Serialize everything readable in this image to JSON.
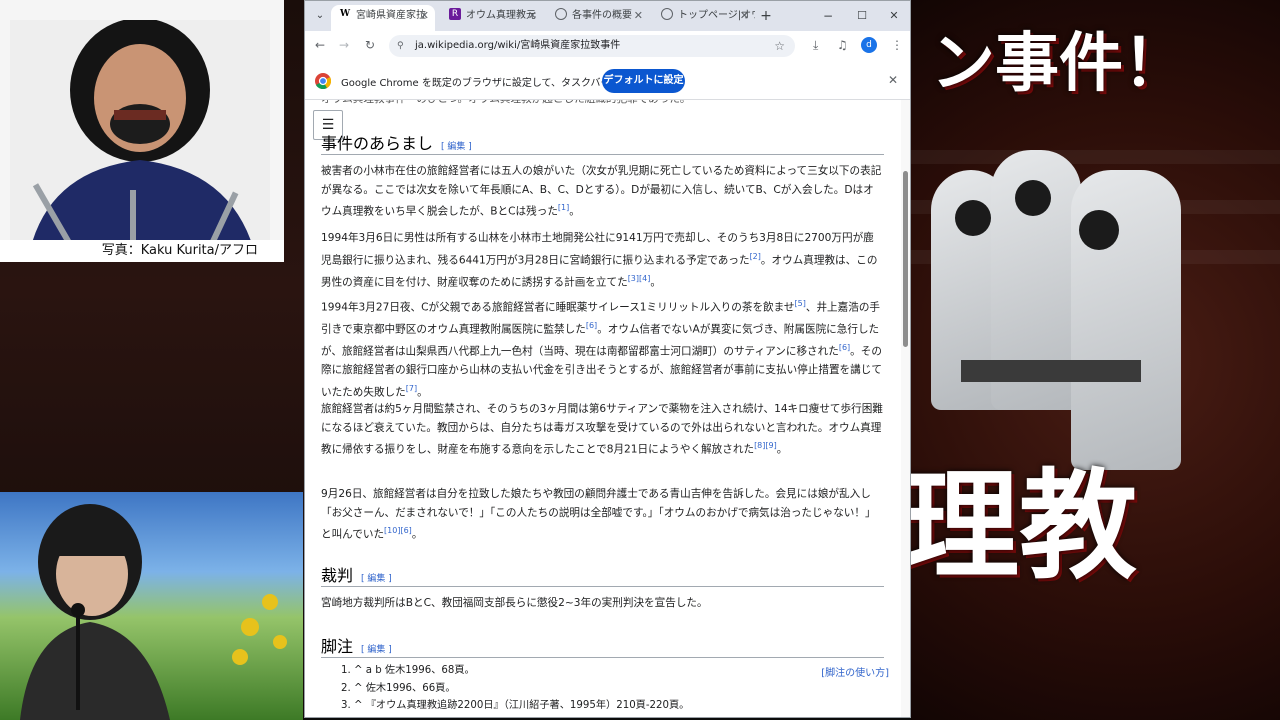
{
  "thumbnail": {
    "headline_top": "ン事件！",
    "headline_bottom": "理教",
    "photo_credit": "写真：Kaku Kurita/アフロ"
  },
  "browser": {
    "tabs": [
      {
        "title": "宮崎県資産家拉",
        "favicon": "W",
        "active": true
      },
      {
        "title": "オウム真理教元",
        "favicon": "R",
        "active": false
      },
      {
        "title": "各事件の概要",
        "favicon": "globe",
        "active": false
      },
      {
        "title": "トップページ|オウ",
        "favicon": "globe",
        "active": false
      }
    ],
    "window_controls": {
      "minimize": "−",
      "maximize": "☐",
      "close": "✕"
    },
    "url": "ja.wikipedia.org/wiki/宮崎県資産家拉致事件",
    "infobar": {
      "message": "Google Chrome を既定のブラウザに設定して、タスクバーに固定する",
      "button": "デフォルトに設定",
      "close": "✕"
    },
    "profile_initial": "d"
  },
  "article": {
    "partial_top": "オウム真理教事件　のひとつ。オウム真理教が起こした組織的犯罪であった。",
    "section1": {
      "title": "事件のあらまし",
      "edit": "編集"
    },
    "p1": "被害者の小林市在住の旅館経営者には五人の娘がいた（次女が乳児期に死亡しているため資料によって三女以下の表記が異なる。ここでは次女を除いて年長順にA、B、C、Dとする）。Dが最初に入信し、続いてB、Cが入会した。Dはオウム真理教をいち早く脱会したが、BとCは残った",
    "p1_ref": "[1]",
    "p2": "1994年3月6日に男性は所有する山林を小林市土地開発公社に9141万円で売却し、そのうち3月8日に2700万円が鹿児島銀行に振り込まれ、残る6441万円が3月28日に宮崎銀行に振り込まれる予定であった",
    "p2_ref": "[2]",
    "p2b": "。オウム真理教は、この男性の資産に目を付け、財産収奪のために誘拐する計画を立てた",
    "p2b_ref": "[3][4]",
    "p3": "1994年3月27日夜、Cが父親である旅館経営者に睡眠薬サイレース1ミリリットル入りの茶を飲ませ",
    "p3_ref1": "[5]",
    "p3b": "、井上嘉浩の手引きで東京都中野区のオウム真理教附属医院に監禁した",
    "p3_ref2": "[6]",
    "p3c": "。オウム信者でないAが異変に気づき、附属医院に急行したが、旅館経営者は山梨県西八代郡上九一色村（当時、現在は南都留郡富士河口湖町）のサティアンに移された",
    "p3_ref3": "[6]",
    "p3d": "。その際に旅館経営者の銀行口座から山林の支払い代金を引き出そうとするが、旅館経営者が事前に支払い停止措置を講じていたため失敗した",
    "p3_ref4": "[7]",
    "p4": "旅館経営者は約5ヶ月間監禁され、そのうちの3ヶ月間は第6サティアンで薬物を注入され続け、14キロ痩せて歩行困難になるほど衰えていた。教団からは、自分たちは毒ガス攻撃を受けているので外は出られないと言われた。オウム真理教に帰依する振りをし、財産を布施する意向を示したことで8月21日にようやく解放された",
    "p4_ref": "[8][9]",
    "p5": "9月26日、旅館経営者は自分を拉致した娘たちや教団の顧問弁護士である青山吉伸を告訴した。会見には娘が乱入し「お父さーん、だまされないで！」「この人たちの説明は全部嘘です。」「オウムのおかげで病気は治ったじゃない！」と叫んでいた",
    "p5_ref": "[10][6]",
    "section2": {
      "title": "裁判",
      "edit": "編集"
    },
    "p6": "宮崎地方裁判所はBとC、教団福岡支部長らに懲役2~3年の実刑判決を宣告した。",
    "section3": {
      "title": "脚注",
      "edit": "編集"
    },
    "footnote_help": "[脚注の使い方]",
    "refs": [
      "1. ^ a b 佐木1996、68頁。",
      "2. ^ 佐木1996、66頁。",
      "3. ^ 『オウム真理教追跡2200日』（江川紹子著、1995年）210頁-220頁。"
    ]
  }
}
